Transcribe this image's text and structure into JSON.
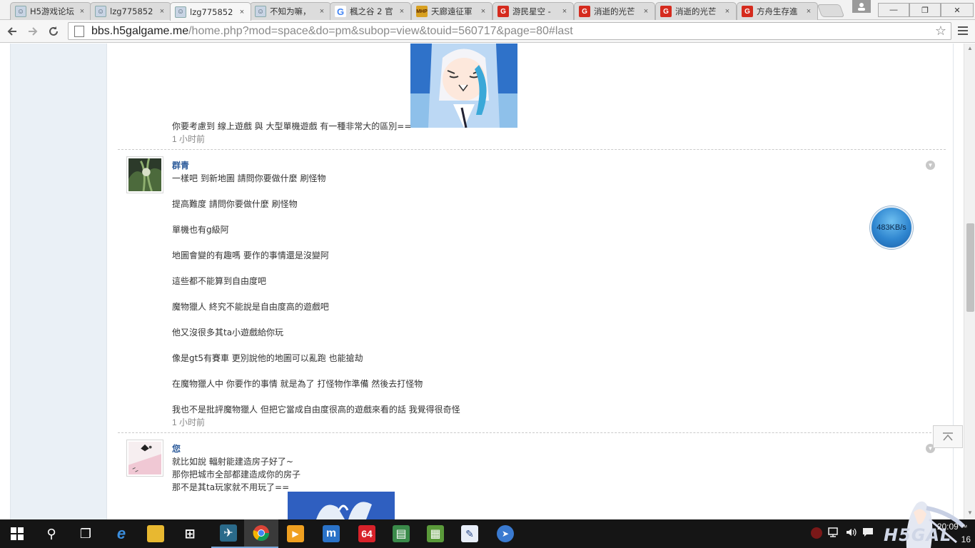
{
  "browser": {
    "tabs": [
      {
        "title": "H5游戏论坛",
        "favicon": "h5-avatar-icon",
        "active": false
      },
      {
        "title": "lzg775852",
        "favicon": "h5-avatar-icon",
        "active": false
      },
      {
        "title": "lzg775852",
        "favicon": "h5-avatar-icon",
        "active": true
      },
      {
        "title": "不知为嘛，",
        "favicon": "h5-avatar-icon",
        "active": false
      },
      {
        "title": "楓之谷 2 官",
        "favicon": "google-icon",
        "active": false
      },
      {
        "title": "天廊遠征軍",
        "favicon": "mhp-icon",
        "active": false
      },
      {
        "title": "游民星空 -",
        "favicon": "gamersky-icon",
        "active": false
      },
      {
        "title": "消逝的光芒",
        "favicon": "gamersky-icon",
        "active": false
      },
      {
        "title": "消逝的光芒",
        "favicon": "gamersky-icon",
        "active": false
      },
      {
        "title": "方舟生存進",
        "favicon": "gamersky-icon",
        "active": false
      }
    ],
    "close_glyph": "×",
    "url_host": "bbs.h5galgame.me",
    "url_path": "/home.php?mod=space&do=pm&subop=view&touid=560717&page=80#last",
    "window_buttons": [
      "—",
      "❐",
      "✕"
    ]
  },
  "messages": [
    {
      "lines": [
        "你要考慮到 線上遊戲 與 大型單機遊戲 有一種非常大的區別=="
      ],
      "time": "1 小时前"
    },
    {
      "user": "群青",
      "lines": [
        "一樣吧 到新地圖   請問你要做什麼  刷怪物",
        "提高難度 請問你要做什麼 刷怪物",
        "單機也有g級阿",
        "地圖會變的有趣嗎   要作的事情還是沒變阿",
        "這些都不能算到自由度吧",
        "魔物獵人 終究不能說是自由度高的遊戲吧",
        "他又沒很多其ta小遊戲給你玩",
        "像是gt5有賽車   更別說他的地圖可以亂跑   也能搶劫",
        "在魔物獵人中 你要作的事情 就是為了 打怪物作準備 然後去打怪物",
        "我也不是批評魔物獵人  但把它當成自由度很高的遊戲來看的話  我覺得很奇怪"
      ],
      "time": "1 小时前"
    },
    {
      "user": "您",
      "lines": [
        "就比如說 輻射能建造房子好了~",
        "那你把城市全部都建造成你的房子",
        "那不是其ta玩家就不用玩了=="
      ]
    }
  ],
  "overlay": {
    "speed": "483KB/s"
  },
  "taskbar": {
    "apps": [
      {
        "name": "search-icon",
        "glyph": "⚲"
      },
      {
        "name": "task-view-icon",
        "glyph": "❐"
      },
      {
        "name": "edge-icon",
        "glyph": "e"
      },
      {
        "name": "file-explorer-icon",
        "glyph": "▬"
      },
      {
        "name": "store-icon",
        "glyph": "⊞"
      },
      {
        "name": "flight-app-icon",
        "glyph": "✈"
      },
      {
        "name": "chrome-icon",
        "glyph": "◉"
      },
      {
        "name": "media-player-icon",
        "glyph": "▶"
      },
      {
        "name": "maxthon-icon",
        "glyph": "m"
      },
      {
        "name": "aida64-icon",
        "glyph": "64"
      },
      {
        "name": "books-icon",
        "glyph": "▤"
      },
      {
        "name": "gpu-card-icon",
        "glyph": "▦"
      },
      {
        "name": "chart-app-icon",
        "glyph": "✎"
      },
      {
        "name": "media-browser-icon",
        "glyph": "➤"
      }
    ],
    "clock_time": "20:09",
    "clock_date": "16",
    "watermark": "H5GAL",
    "tray_mark": "™"
  },
  "colors": {
    "link_blue": "#2b5a9a",
    "sidebar_bg": "#eaf0f6",
    "taskbar_bg": "#151515",
    "speed_ball": "#2f86d0"
  }
}
